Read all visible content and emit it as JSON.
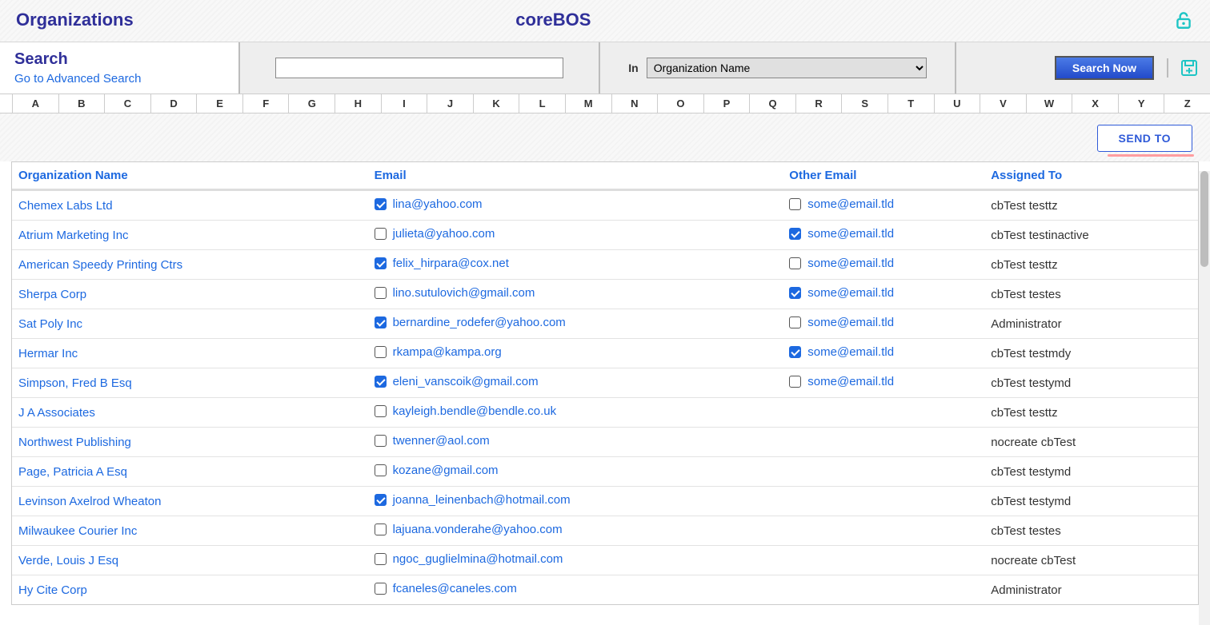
{
  "header": {
    "page_title": "Organizations",
    "brand": "coreBOS"
  },
  "search": {
    "heading": "Search",
    "advanced_link": "Go to Advanced Search",
    "input_value": "",
    "in_label": "In",
    "in_selected": "Organization Name",
    "search_btn": "Search Now"
  },
  "alpha": [
    "A",
    "B",
    "C",
    "D",
    "E",
    "F",
    "G",
    "H",
    "I",
    "J",
    "K",
    "L",
    "M",
    "N",
    "O",
    "P",
    "Q",
    "R",
    "S",
    "T",
    "U",
    "V",
    "W",
    "X",
    "Y",
    "Z"
  ],
  "sendto_label": "SEND TO",
  "table": {
    "headers": {
      "org": "Organization Name",
      "email": "Email",
      "other": "Other Email",
      "assigned": "Assigned To"
    },
    "rows": [
      {
        "org": "Chemex Labs Ltd",
        "email": "lina@yahoo.com",
        "email_checked": true,
        "other": "some@email.tld",
        "other_checked": false,
        "assigned": "cbTest testtz"
      },
      {
        "org": "Atrium Marketing Inc",
        "email": "julieta@yahoo.com",
        "email_checked": false,
        "other": "some@email.tld",
        "other_checked": true,
        "assigned": "cbTest testinactive"
      },
      {
        "org": "American Speedy Printing Ctrs",
        "email": "felix_hirpara@cox.net",
        "email_checked": true,
        "other": "some@email.tld",
        "other_checked": false,
        "assigned": "cbTest testtz"
      },
      {
        "org": "Sherpa Corp",
        "email": "lino.sutulovich@gmail.com",
        "email_checked": false,
        "other": "some@email.tld",
        "other_checked": true,
        "assigned": "cbTest testes"
      },
      {
        "org": "Sat Poly Inc",
        "email": "bernardine_rodefer@yahoo.com",
        "email_checked": true,
        "other": "some@email.tld",
        "other_checked": false,
        "assigned": "Administrator"
      },
      {
        "org": "Hermar Inc",
        "email": "rkampa@kampa.org",
        "email_checked": false,
        "other": "some@email.tld",
        "other_checked": true,
        "assigned": "cbTest testmdy"
      },
      {
        "org": "Simpson, Fred B Esq",
        "email": "eleni_vanscoik@gmail.com",
        "email_checked": true,
        "other": "some@email.tld",
        "other_checked": false,
        "assigned": "cbTest testymd"
      },
      {
        "org": "J A Associates",
        "email": "kayleigh.bendle@bendle.co.uk",
        "email_checked": false,
        "other": "",
        "other_checked": null,
        "assigned": "cbTest testtz"
      },
      {
        "org": "Northwest Publishing",
        "email": "twenner@aol.com",
        "email_checked": false,
        "other": "",
        "other_checked": null,
        "assigned": "nocreate cbTest"
      },
      {
        "org": "Page, Patricia A Esq",
        "email": "kozane@gmail.com",
        "email_checked": false,
        "other": "",
        "other_checked": null,
        "assigned": "cbTest testymd"
      },
      {
        "org": "Levinson Axelrod Wheaton",
        "email": "joanna_leinenbach@hotmail.com",
        "email_checked": true,
        "other": "",
        "other_checked": null,
        "assigned": "cbTest testymd"
      },
      {
        "org": "Milwaukee Courier Inc",
        "email": "lajuana.vonderahe@yahoo.com",
        "email_checked": false,
        "other": "",
        "other_checked": null,
        "assigned": "cbTest testes"
      },
      {
        "org": "Verde, Louis J Esq",
        "email": "ngoc_guglielmina@hotmail.com",
        "email_checked": false,
        "other": "",
        "other_checked": null,
        "assigned": "nocreate cbTest"
      },
      {
        "org": "Hy Cite Corp",
        "email": "fcaneles@caneles.com",
        "email_checked": false,
        "other": "",
        "other_checked": null,
        "assigned": "Administrator"
      }
    ]
  }
}
